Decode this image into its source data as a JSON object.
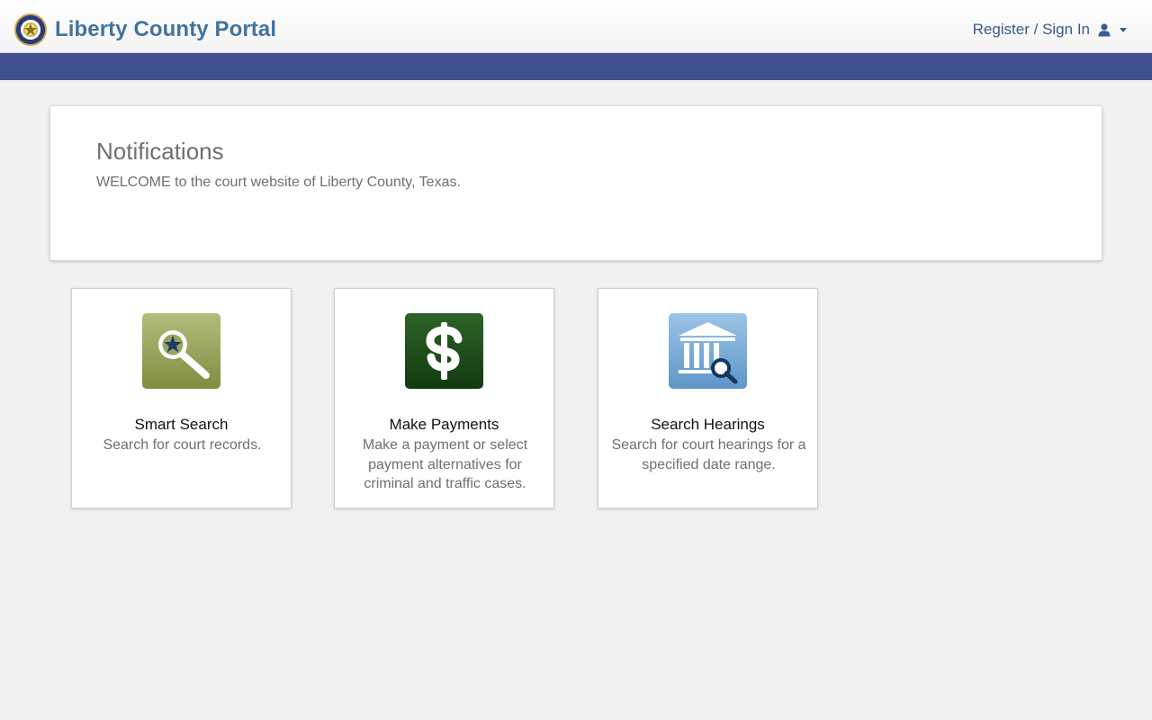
{
  "header": {
    "title": "Liberty County Portal",
    "signin_label": "Register / Sign In",
    "logo_icon": "county-seal-icon",
    "user_icon": "user-icon"
  },
  "colors": {
    "brand_text": "#41739f",
    "nav_band": "#41518f",
    "smart_search_tile": "#8f9c4e",
    "payments_tile": "#1d4a18",
    "hearings_tile": "#6aa0cf"
  },
  "notifications": {
    "heading": "Notifications",
    "message": "WELCOME to the court website of Liberty County, Texas."
  },
  "tiles": [
    {
      "title": "Smart Search",
      "description": "Search for court records.",
      "icon": "magnifier-star-icon"
    },
    {
      "title": "Make Payments",
      "description": "Make a payment or select payment alternatives for criminal and traffic cases.",
      "icon": "dollar-sign-icon"
    },
    {
      "title": "Search Hearings",
      "description": "Search for court hearings for a specified date range.",
      "icon": "courthouse-search-icon"
    }
  ]
}
